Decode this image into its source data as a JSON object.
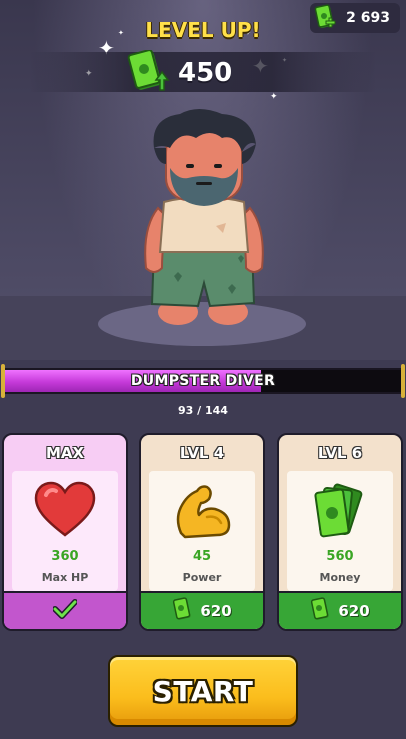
{
  "currency": {
    "amount": "2 693",
    "icon": "cash-plus-icon"
  },
  "header": {
    "title": "LEVEL UP!",
    "reward_amount": "450",
    "reward_icon": "cash-up-icon"
  },
  "character": {
    "name": "DUMPSTER DIVER",
    "icon": "hobo-character"
  },
  "progress": {
    "text": "93 / 144",
    "current": 93,
    "max": 144
  },
  "cards": [
    {
      "title": "MAX",
      "icon": "heart-icon",
      "value": "360",
      "label": "Max HP",
      "action_label": "",
      "action_icon": "checkmark-icon",
      "maxed": true
    },
    {
      "title": "LVL 4",
      "icon": "flexed-arm-icon",
      "value": "45",
      "label": "Power",
      "action_label": "620",
      "action_icon": "cash-icon",
      "maxed": false
    },
    {
      "title": "LVL 6",
      "icon": "cash-stack-icon",
      "value": "560",
      "label": "Money",
      "action_label": "620",
      "action_icon": "cash-icon",
      "maxed": false
    }
  ],
  "start_label": "START",
  "colors": {
    "progress_fill": "#c53ad9",
    "upgrade_green": "#37a636",
    "maxed_purple": "#c256cd",
    "start_yellow": "#fbbd1c",
    "title_yellow": "#ffe04a"
  }
}
